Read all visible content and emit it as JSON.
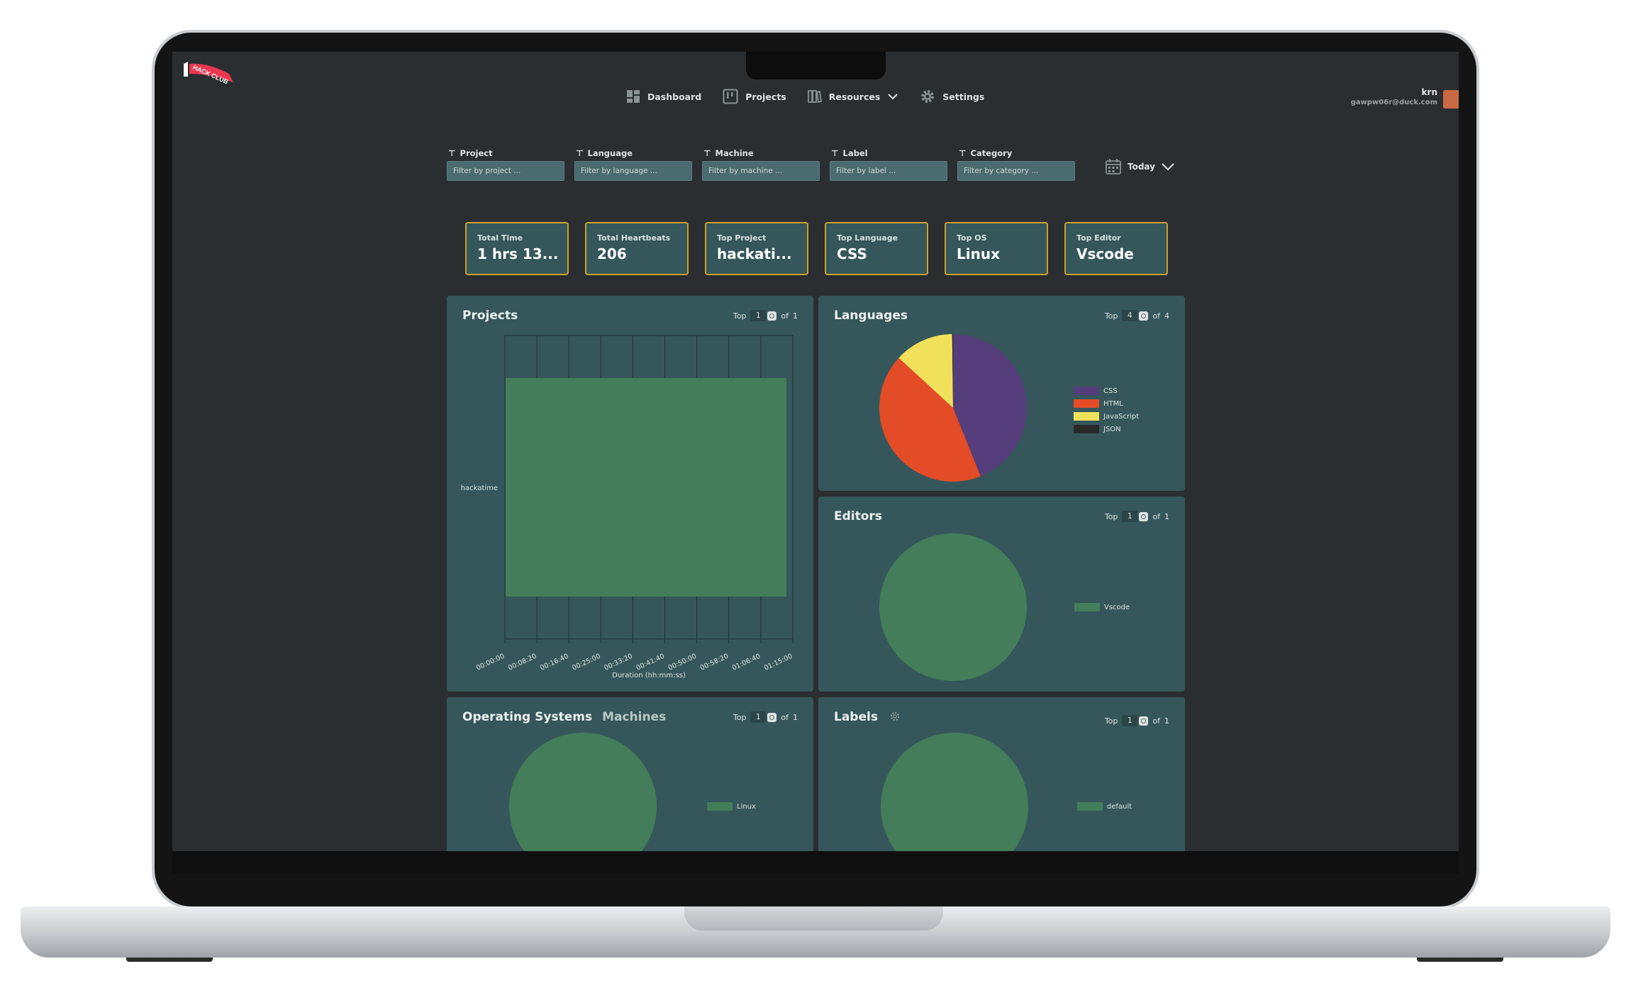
{
  "app": {
    "logo_text": "HACK CLUB"
  },
  "nav": {
    "items": [
      {
        "label": "Dashboard",
        "icon": "dashboard-icon"
      },
      {
        "label": "Projects",
        "icon": "projects-icon"
      },
      {
        "label": "Resources",
        "icon": "resources-icon"
      },
      {
        "label": "Settings",
        "icon": "settings-icon"
      }
    ]
  },
  "user": {
    "name": "krn",
    "email": "gawpw06r@duck.com"
  },
  "filters": [
    {
      "label": "Project",
      "placeholder": "Filter by project ..."
    },
    {
      "label": "Language",
      "placeholder": "Filter by language ..."
    },
    {
      "label": "Machine",
      "placeholder": "Filter by machine ..."
    },
    {
      "label": "Label",
      "placeholder": "Filter by label ..."
    },
    {
      "label": "Category",
      "placeholder": "Filter by category ..."
    }
  ],
  "date_filter": {
    "label": "Today"
  },
  "stats": [
    {
      "label": "Total Time",
      "value": "1 hrs 13..."
    },
    {
      "label": "Total Heartbeats",
      "value": "206"
    },
    {
      "label": "Top Project",
      "value": "hackati..."
    },
    {
      "label": "Top Language",
      "value": "CSS"
    },
    {
      "label": "Top OS",
      "value": "Linux"
    },
    {
      "label": "Top Editor",
      "value": "Vscode"
    }
  ],
  "cards": {
    "projects": {
      "title": "Projects",
      "top_label": "Top",
      "top_value": "1",
      "of_label": "of",
      "of_total": "1"
    },
    "languages": {
      "title": "Languages",
      "top_label": "Top",
      "top_value": "4",
      "of_label": "of",
      "of_total": "4"
    },
    "editors": {
      "title": "Editors",
      "top_label": "Top",
      "top_value": "1",
      "of_label": "of",
      "of_total": "1"
    },
    "os": {
      "title": "Operating Systems",
      "alt_title": "Machines",
      "top_label": "Top",
      "top_value": "1",
      "of_label": "of",
      "of_total": "1"
    },
    "labels": {
      "title": "Labels",
      "top_label": "Top",
      "top_value": "1",
      "of_label": "of",
      "of_total": "1"
    }
  },
  "colors": {
    "card_bg": "#35575b",
    "accent_border": "#c9a227",
    "bar_green": "#437d59"
  },
  "chart_data": [
    {
      "type": "bar",
      "orientation": "horizontal",
      "categories": [
        "hackatime"
      ],
      "values": [
        4390
      ],
      "xlabel": "Duration (hh:mm:ss)",
      "xticks": [
        "00:00:00",
        "00:08:20",
        "00:16:40",
        "00:25:00",
        "00:33:20",
        "00:41:40",
        "00:50:00",
        "00:58:20",
        "01:06:40",
        "01:15:00"
      ],
      "xlim": [
        0,
        4500
      ],
      "grid": true,
      "color": "#437d59"
    },
    {
      "type": "pie",
      "labels": [
        "CSS",
        "HTML",
        "JavaScript",
        "JSON"
      ],
      "values": [
        44,
        43,
        13,
        0.2
      ],
      "colors": [
        "#563d7c",
        "#e34c26",
        "#f1e05a",
        "#292929"
      ],
      "legend": "right"
    },
    {
      "type": "pie",
      "labels": [
        "Vscode"
      ],
      "values": [
        100
      ],
      "colors": [
        "#437d59"
      ],
      "legend": "right"
    },
    {
      "type": "pie",
      "labels": [
        "Linux"
      ],
      "values": [
        100
      ],
      "colors": [
        "#437d59"
      ],
      "legend": "right"
    },
    {
      "type": "pie",
      "labels": [
        "default"
      ],
      "values": [
        100
      ],
      "colors": [
        "#437d59"
      ],
      "legend": "right"
    }
  ]
}
